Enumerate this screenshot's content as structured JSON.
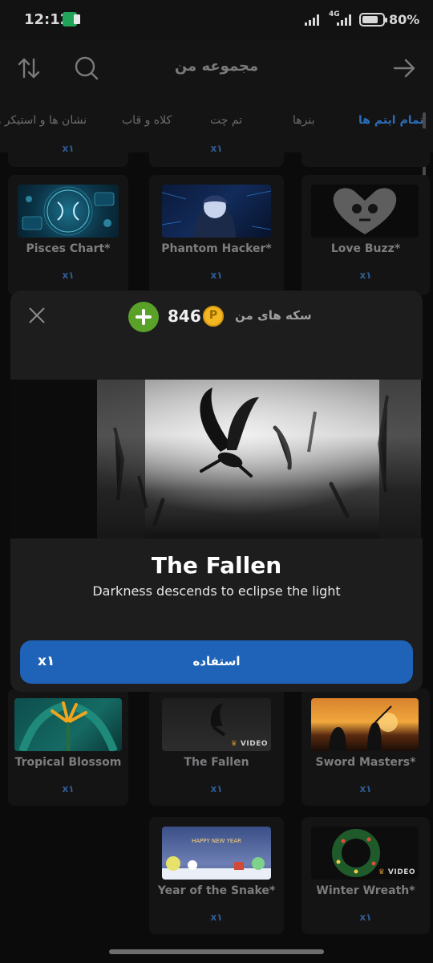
{
  "status": {
    "time": "12:12",
    "network": "4G",
    "battery": "80%",
    "battery_level": 0.8
  },
  "header": {
    "title": "مجموعه من",
    "icons": [
      "sort-icon",
      "search-icon",
      "forward-arrow-icon"
    ]
  },
  "tabs": [
    {
      "label": "تمام ایتم ها",
      "active": true
    },
    {
      "label": "بنرها"
    },
    {
      "label": "تم چت"
    },
    {
      "label": "کلاه و قاب"
    },
    {
      "label": "نشان ها و استیکر ها"
    }
  ],
  "grid": {
    "top_row_qty": [
      "x۱",
      "x۱"
    ],
    "row1": [
      {
        "name": "Pisces Chart*",
        "qty": "x۱"
      },
      {
        "name": "Phantom Hacker*",
        "qty": "x۱"
      },
      {
        "name": "Love Buzz*",
        "qty": "x۱"
      }
    ],
    "row2": [
      {
        "name": "Tropical Blossom",
        "qty": "x۱"
      },
      {
        "name": "The Fallen",
        "qty": "x۱",
        "tag": "VIDEO"
      },
      {
        "name": "Sword Masters*",
        "qty": "x۱"
      }
    ],
    "row3": [
      {
        "name": "Year of the Snake*",
        "qty": "x۱"
      },
      {
        "name": "Winter Wreath*",
        "qty": "x۱",
        "tag": "VIDEO"
      }
    ]
  },
  "modal": {
    "coins_label": "سکه های من",
    "coins": "846",
    "coin_symbol": "P",
    "item_title": "The Fallen",
    "item_description": "Darkness descends to eclipse the light",
    "use_button": "استفاده",
    "quantity": "x۱"
  },
  "colors": {
    "accent": "#1f63b9",
    "add": "#5aa12a",
    "coin": "#f2b721",
    "tab_active": "#2c6db8"
  }
}
